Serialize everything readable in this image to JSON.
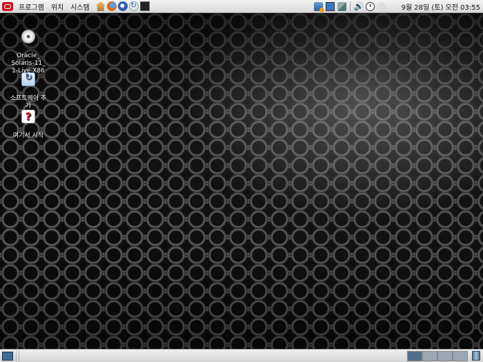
{
  "top_panel": {
    "menus": [
      "프로그램",
      "위치",
      "시스템"
    ],
    "launchers": [
      "home-icon",
      "firefox-icon",
      "thunderbird-icon",
      "update-manager-icon",
      "terminal-icon"
    ],
    "tray_icons": [
      "package-update-icon",
      "display-icon",
      "network-icon",
      "volume-icon",
      "clock-icon",
      "user-switcher-icon"
    ],
    "clock": "9월 28일 (토) 오전 03:55"
  },
  "desktop": {
    "icons": [
      {
        "label": "Oracle_\nSolaris-11_\n1-Live-X86",
        "icon": "disc-icon"
      },
      {
        "label": "소프트웨어 추\n가",
        "icon": "add-software-icon"
      },
      {
        "label": "여기서 시작",
        "icon": "help-icon"
      }
    ]
  },
  "bottom_panel": {
    "workspaces": 4,
    "active_workspace": 1
  }
}
